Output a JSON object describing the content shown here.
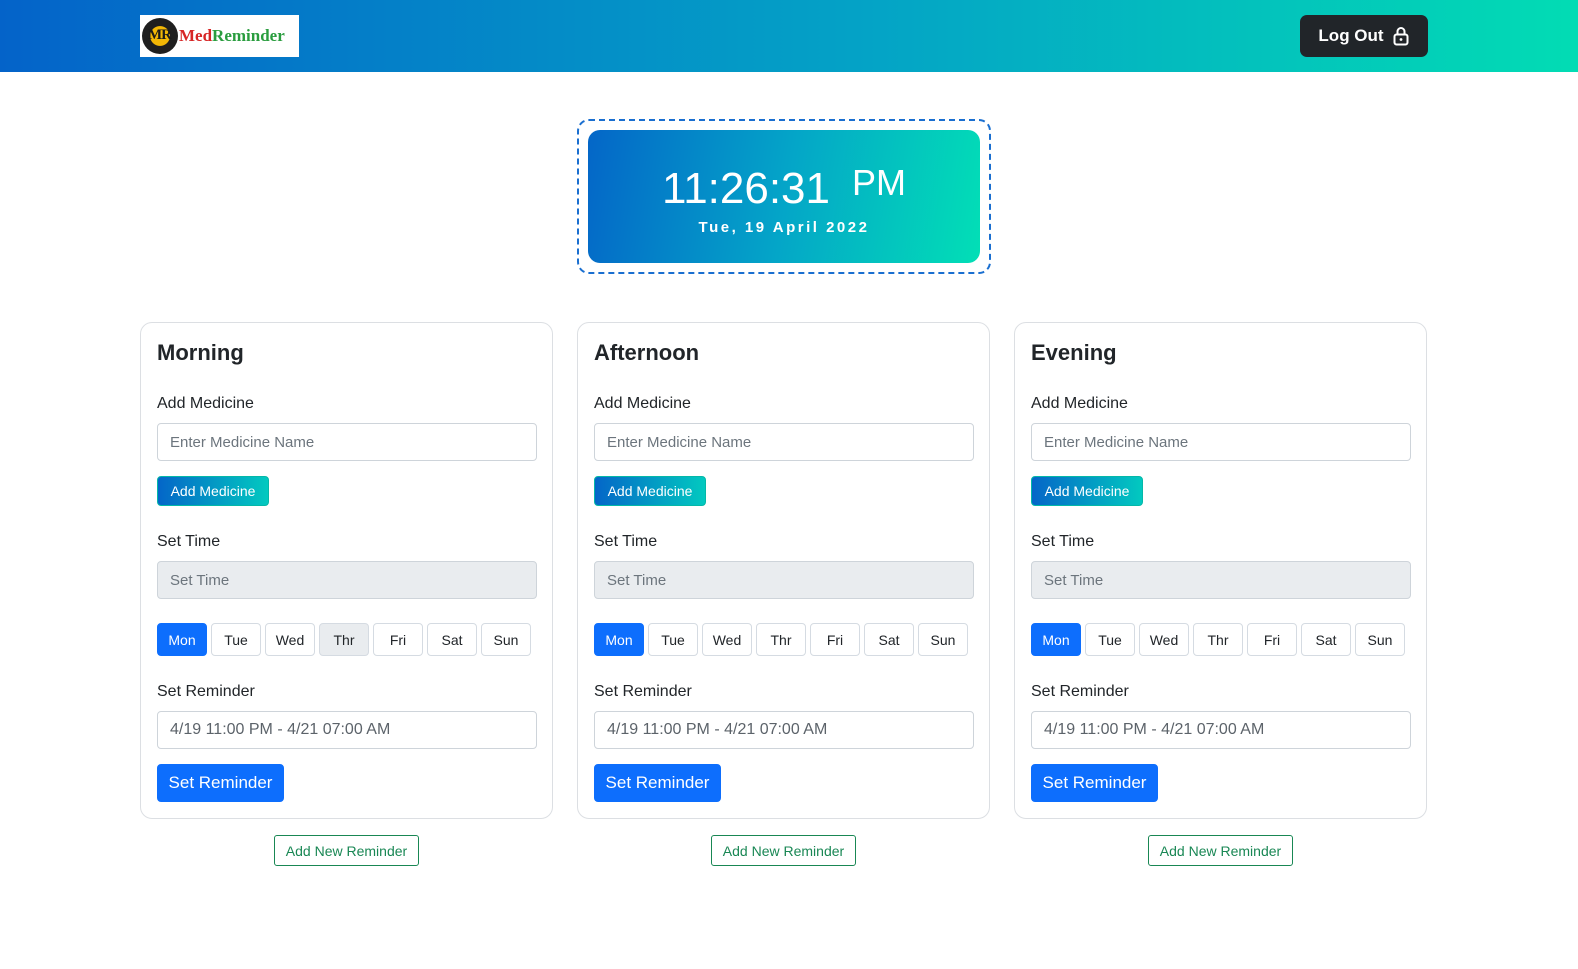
{
  "app": {
    "logo_prefix": "Med",
    "logo_suffix": "Reminder",
    "logo_mark": "MR"
  },
  "nav": {
    "logout_label": "Log Out",
    "logout_icon": "lock-icon"
  },
  "clock": {
    "time": "11:26:31",
    "ampm": "PM",
    "date": "Tue, 19 April 2022"
  },
  "cards": [
    {
      "title": "Morning",
      "add_medicine_label": "Add Medicine",
      "medicine_placeholder": "Enter Medicine Name",
      "add_medicine_button": "Add Medicine",
      "set_time_label": "Set Time",
      "set_time_placeholder": "Set Time",
      "days": [
        "Mon",
        "Tue",
        "Wed",
        "Thr",
        "Fri",
        "Sat",
        "Sun"
      ],
      "active_day": "Mon",
      "set_reminder_label": "Set Reminder",
      "reminder_range": "4/19 11:00 PM - 4/21 07:00 AM",
      "set_reminder_button": "Set Reminder",
      "add_new_button": "Add New Reminder"
    },
    {
      "title": "Afternoon",
      "add_medicine_label": "Add Medicine",
      "medicine_placeholder": "Enter Medicine Name",
      "add_medicine_button": "Add Medicine",
      "set_time_label": "Set Time",
      "set_time_placeholder": "Set Time",
      "days": [
        "Mon",
        "Tue",
        "Wed",
        "Thr",
        "Fri",
        "Sat",
        "Sun"
      ],
      "active_day": "Mon",
      "set_reminder_label": "Set Reminder",
      "reminder_range": "4/19 11:00 PM - 4/21 07:00 AM",
      "set_reminder_button": "Set Reminder",
      "add_new_button": "Add New Reminder"
    },
    {
      "title": "Evening",
      "add_medicine_label": "Add Medicine",
      "medicine_placeholder": "Enter Medicine Name",
      "add_medicine_button": "Add Medicine",
      "set_time_label": "Set Time",
      "set_time_placeholder": "Set Time",
      "days": [
        "Mon",
        "Tue",
        "Wed",
        "Thr",
        "Fri",
        "Sat",
        "Sun"
      ],
      "active_day": "Mon",
      "set_reminder_label": "Set Reminder",
      "reminder_range": "4/19 11:00 PM - 4/21 07:00 AM",
      "set_reminder_button": "Set Reminder",
      "add_new_button": "Add New Reminder"
    }
  ],
  "colors": {
    "primary": "#0d6efd",
    "gradient_start": "#0463c9",
    "gradient_end": "#02dcb4",
    "success": "#198754",
    "dark": "#212529"
  }
}
